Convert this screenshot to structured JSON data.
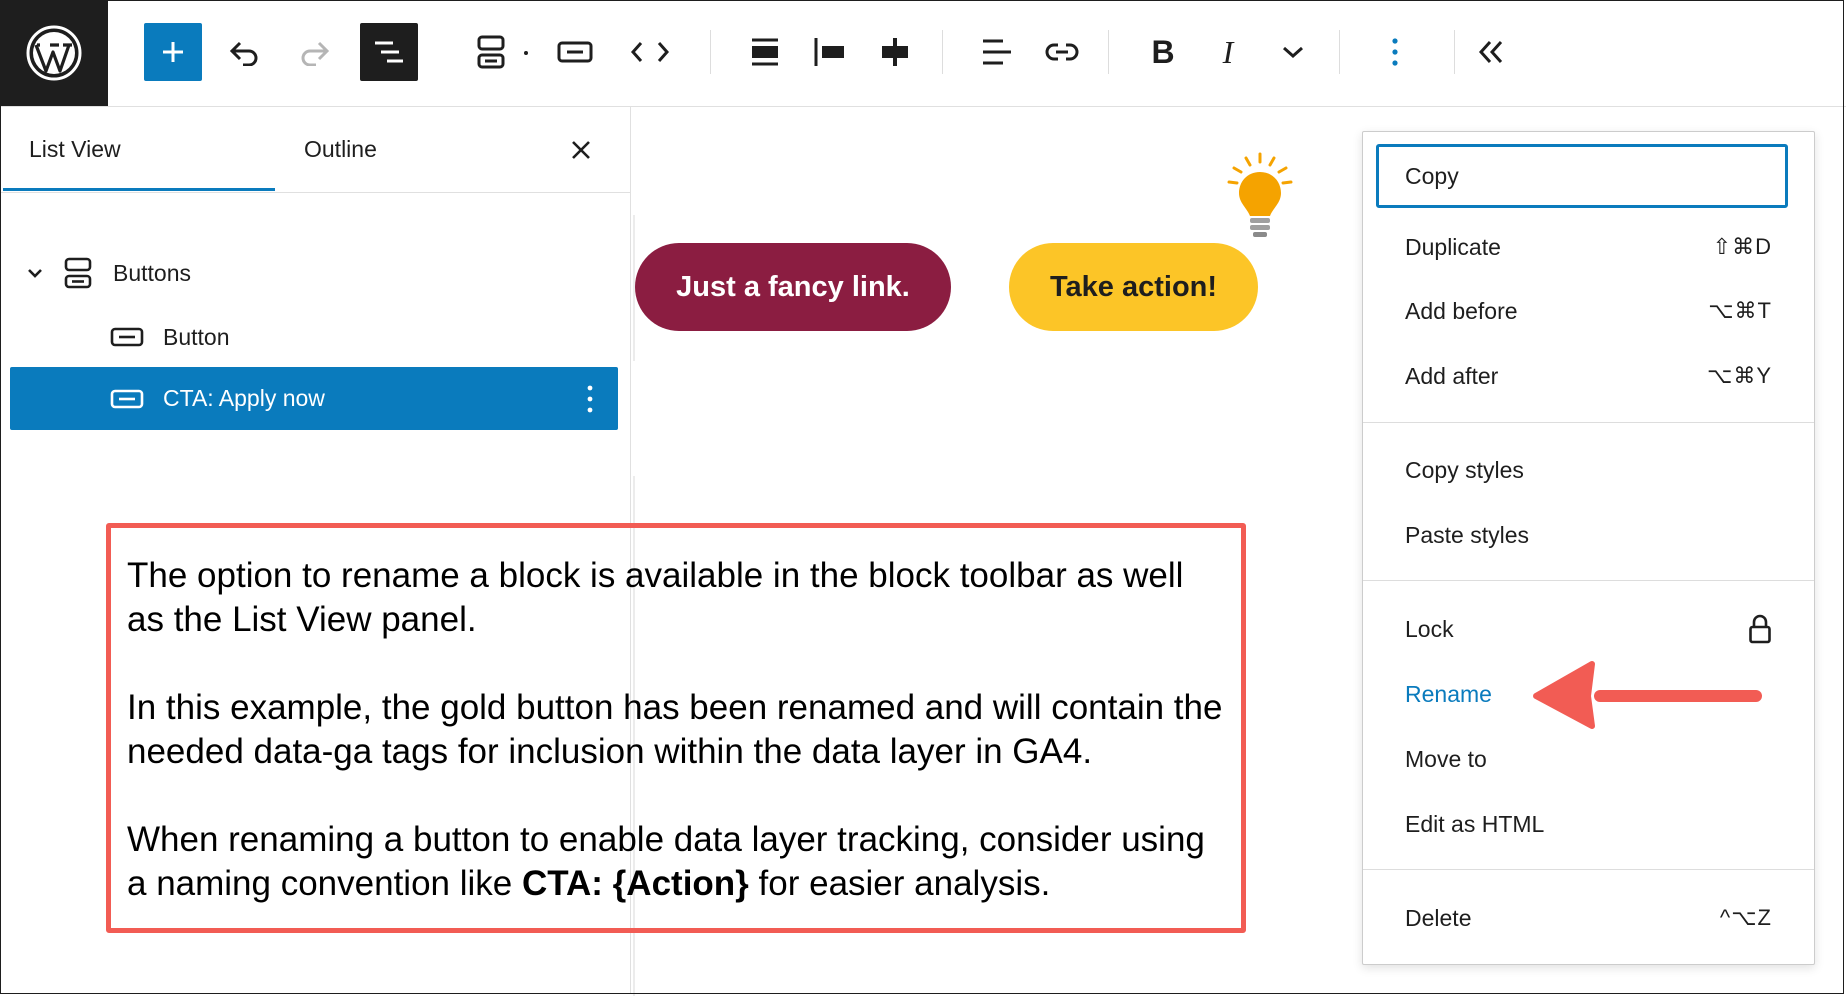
{
  "toolbar": {
    "icons": [
      "wordpress-logo",
      "add-block",
      "undo",
      "redo",
      "document-overview",
      "block-type-buttons",
      "block-type-button",
      "move-arrows",
      "align",
      "justify-left",
      "justify-center",
      "text-align",
      "link",
      "bold",
      "italic",
      "more-rich-text",
      "options",
      "collapse"
    ],
    "accent": "#0a7bbd"
  },
  "panel": {
    "tabs": [
      "List View",
      "Outline"
    ],
    "items": [
      {
        "label": "Buttons"
      },
      {
        "label": "Button"
      },
      {
        "label": "CTA: Apply now"
      }
    ]
  },
  "canvas": {
    "button1": {
      "label": "Just a fancy link.",
      "color": "#8b1d41"
    },
    "button2": {
      "label": "Take action!",
      "color": "#fcc527"
    }
  },
  "info": {
    "p1": "The option to rename a block is available in the block toolbar as well as the List View panel.",
    "p2": "In this example, the gold button has been renamed and will contain the needed data-ga tags for inclusion within the data layer in GA4.",
    "p3_start": "When renaming a button to enable data layer tracking, consider using a naming convention like ",
    "p3_bold": "CTA: {Action}",
    "p3_end": " for easier analysis.",
    "border_color": "#f25c54"
  },
  "menu": {
    "copy": "Copy",
    "duplicate": {
      "label": "Duplicate",
      "shortcut": "⇧⌘D"
    },
    "add_before": {
      "label": "Add before",
      "shortcut": "⌥⌘T"
    },
    "add_after": {
      "label": "Add after",
      "shortcut": "⌥⌘Y"
    },
    "copy_styles": "Copy styles",
    "paste_styles": "Paste styles",
    "lock": "Lock",
    "rename": "Rename",
    "move_to": "Move to",
    "edit_html": "Edit as HTML",
    "delete": {
      "label": "Delete",
      "shortcut": "^⌥Z"
    }
  }
}
